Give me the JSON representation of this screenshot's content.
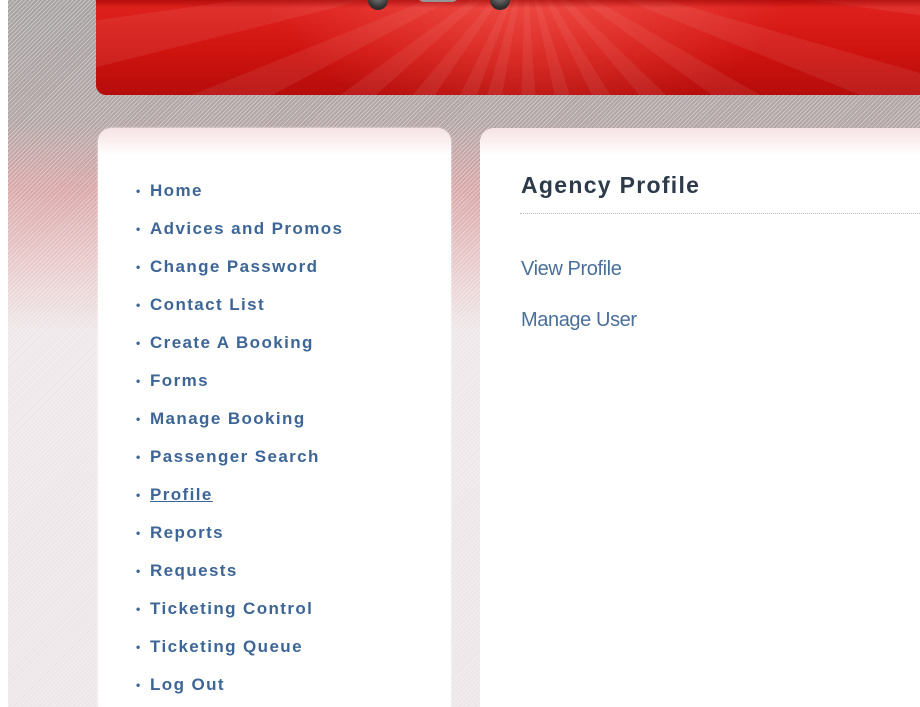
{
  "sidebar": {
    "bullet": "•",
    "items": [
      {
        "label": "Home"
      },
      {
        "label": "Advices and Promos"
      },
      {
        "label": "Change Password"
      },
      {
        "label": "Contact List"
      },
      {
        "label": "Create A Booking"
      },
      {
        "label": "Forms"
      },
      {
        "label": "Manage Booking"
      },
      {
        "label": "Passenger Search"
      },
      {
        "label": "Profile",
        "active": true
      },
      {
        "label": "Reports"
      },
      {
        "label": "Requests"
      },
      {
        "label": "Ticketing Control"
      },
      {
        "label": "Ticketing Queue"
      },
      {
        "label": "Log Out"
      }
    ]
  },
  "main": {
    "title": "Agency Profile",
    "links": [
      {
        "label": "View Profile"
      },
      {
        "label": "Manage User"
      }
    ]
  },
  "colors": {
    "banner_red": "#cf130f",
    "nav_link": "#3d6596",
    "title_text": "#2c3a4a",
    "sub_link": "#4a6f9a"
  }
}
